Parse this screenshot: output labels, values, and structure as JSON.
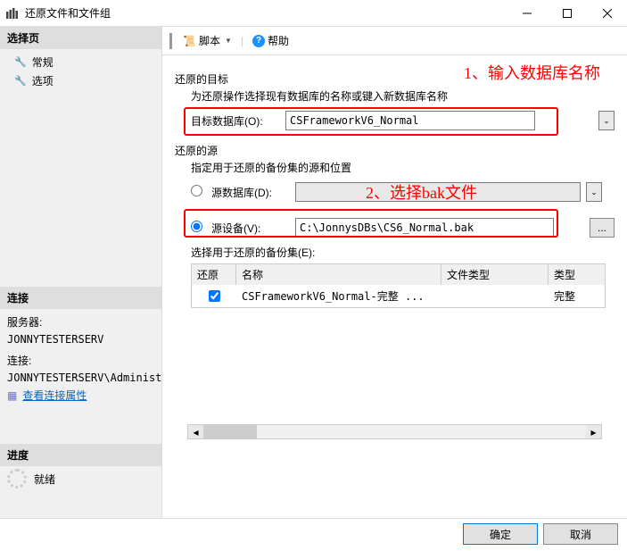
{
  "window": {
    "title": "还原文件和文件组"
  },
  "sidebar": {
    "select_page": "选择页",
    "items": [
      {
        "label": "常规"
      },
      {
        "label": "选项"
      }
    ],
    "connection": "连接",
    "server_label": "服务器:",
    "server_value": "JONNYTESTERSERV",
    "conn_label": "连接:",
    "conn_value": "JONNYTESTERSERV\\Administrat",
    "view_conn_props": "查看连接属性",
    "progress": "进度",
    "ready": "就绪"
  },
  "toolbar": {
    "script": "脚本",
    "help": "帮助"
  },
  "annot": {
    "one": "1、输入数据库名称",
    "two": "2、选择bak文件"
  },
  "target": {
    "title": "还原的目标",
    "subtitle": "为还原操作选择现有数据库的名称或键入新数据库名称",
    "db_label": "目标数据库(O):",
    "db_value": "CSFrameworkV6_Normal"
  },
  "source": {
    "title": "还原的源",
    "subtitle": "指定用于还原的备份集的源和位置",
    "src_db_label": "源数据库(D):",
    "src_db_value": "",
    "src_dev_label": "源设备(V):",
    "src_dev_value": "C:\\JonnysDBs\\CS6_Normal.bak",
    "select_sets": "选择用于还原的备份集(E):"
  },
  "table": {
    "cols": {
      "restore": "还原",
      "name": "名称",
      "type": "文件类型",
      "kind": "类型"
    },
    "rows": [
      {
        "checked": true,
        "name": "CSFrameworkV6_Normal-完整 ...",
        "type": "",
        "kind": "完整"
      }
    ]
  },
  "footer": {
    "ok": "确定",
    "cancel": "取消"
  }
}
